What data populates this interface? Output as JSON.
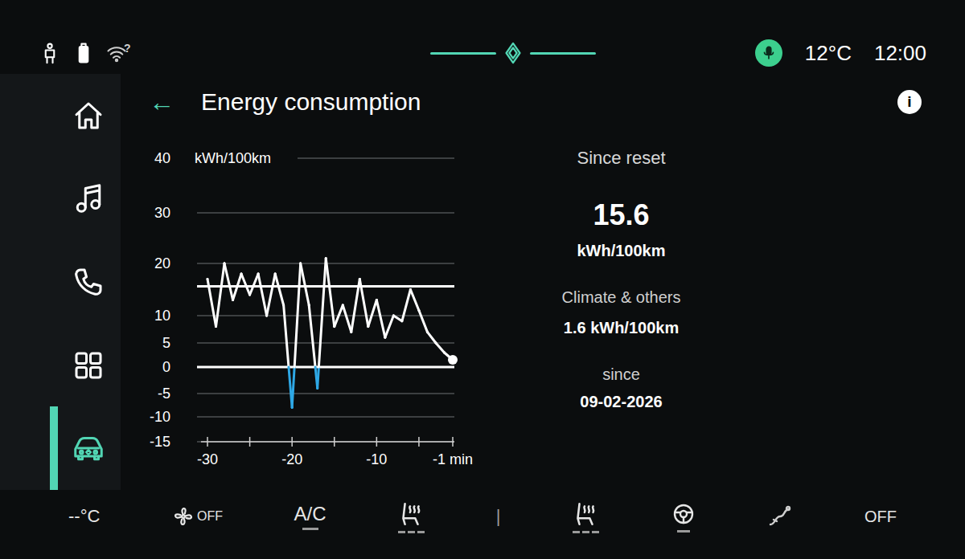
{
  "status_bar": {
    "wifi_mark": "?",
    "temperature": "12°C",
    "time": "12:00"
  },
  "sidebar": {
    "items": [
      {
        "kind": "home",
        "selected": false
      },
      {
        "kind": "music",
        "selected": false
      },
      {
        "kind": "phone",
        "selected": false
      },
      {
        "kind": "apps",
        "selected": false
      },
      {
        "kind": "vehicle",
        "selected": true
      }
    ]
  },
  "header": {
    "back": "←",
    "title": "Energy consumption",
    "info": "i"
  },
  "chart": {
    "unit": "kWh/100km",
    "y_ticks": [
      "40",
      "30",
      "20",
      "10",
      "5",
      "0",
      "-5",
      "-10",
      "-15"
    ],
    "x_ticks": [
      "-30",
      "-20",
      "-10",
      "-1 min"
    ],
    "reference_lines": [
      15.6,
      0
    ],
    "series": [
      {
        "values": [
          17,
          8,
          20,
          13,
          18,
          14,
          18,
          10,
          18,
          12,
          -8,
          20,
          12,
          -4,
          21,
          8,
          12,
          7,
          17,
          8,
          13,
          6,
          10,
          9,
          15,
          11,
          7,
          5,
          3,
          1.5
        ]
      }
    ]
  },
  "summary": {
    "title": "Since reset",
    "value": "15.6",
    "unit": "kWh/100km",
    "climate_label": "Climate & others",
    "climate_value": "1.6 kWh/100km",
    "since_label": "since",
    "since_date": "09-02-2026"
  },
  "bottom_bar": {
    "items": [
      {
        "kind": "temp",
        "text": "--°C"
      },
      {
        "kind": "fan",
        "text": "OFF"
      },
      {
        "kind": "ac",
        "text": "A/C",
        "on": false
      },
      {
        "kind": "seat",
        "level": 0
      },
      {
        "kind": "divider",
        "text": "|"
      },
      {
        "kind": "seat",
        "level": 0
      },
      {
        "kind": "wheel",
        "on": false
      },
      {
        "kind": "assist"
      },
      {
        "kind": "label",
        "text": "OFF"
      }
    ]
  }
}
